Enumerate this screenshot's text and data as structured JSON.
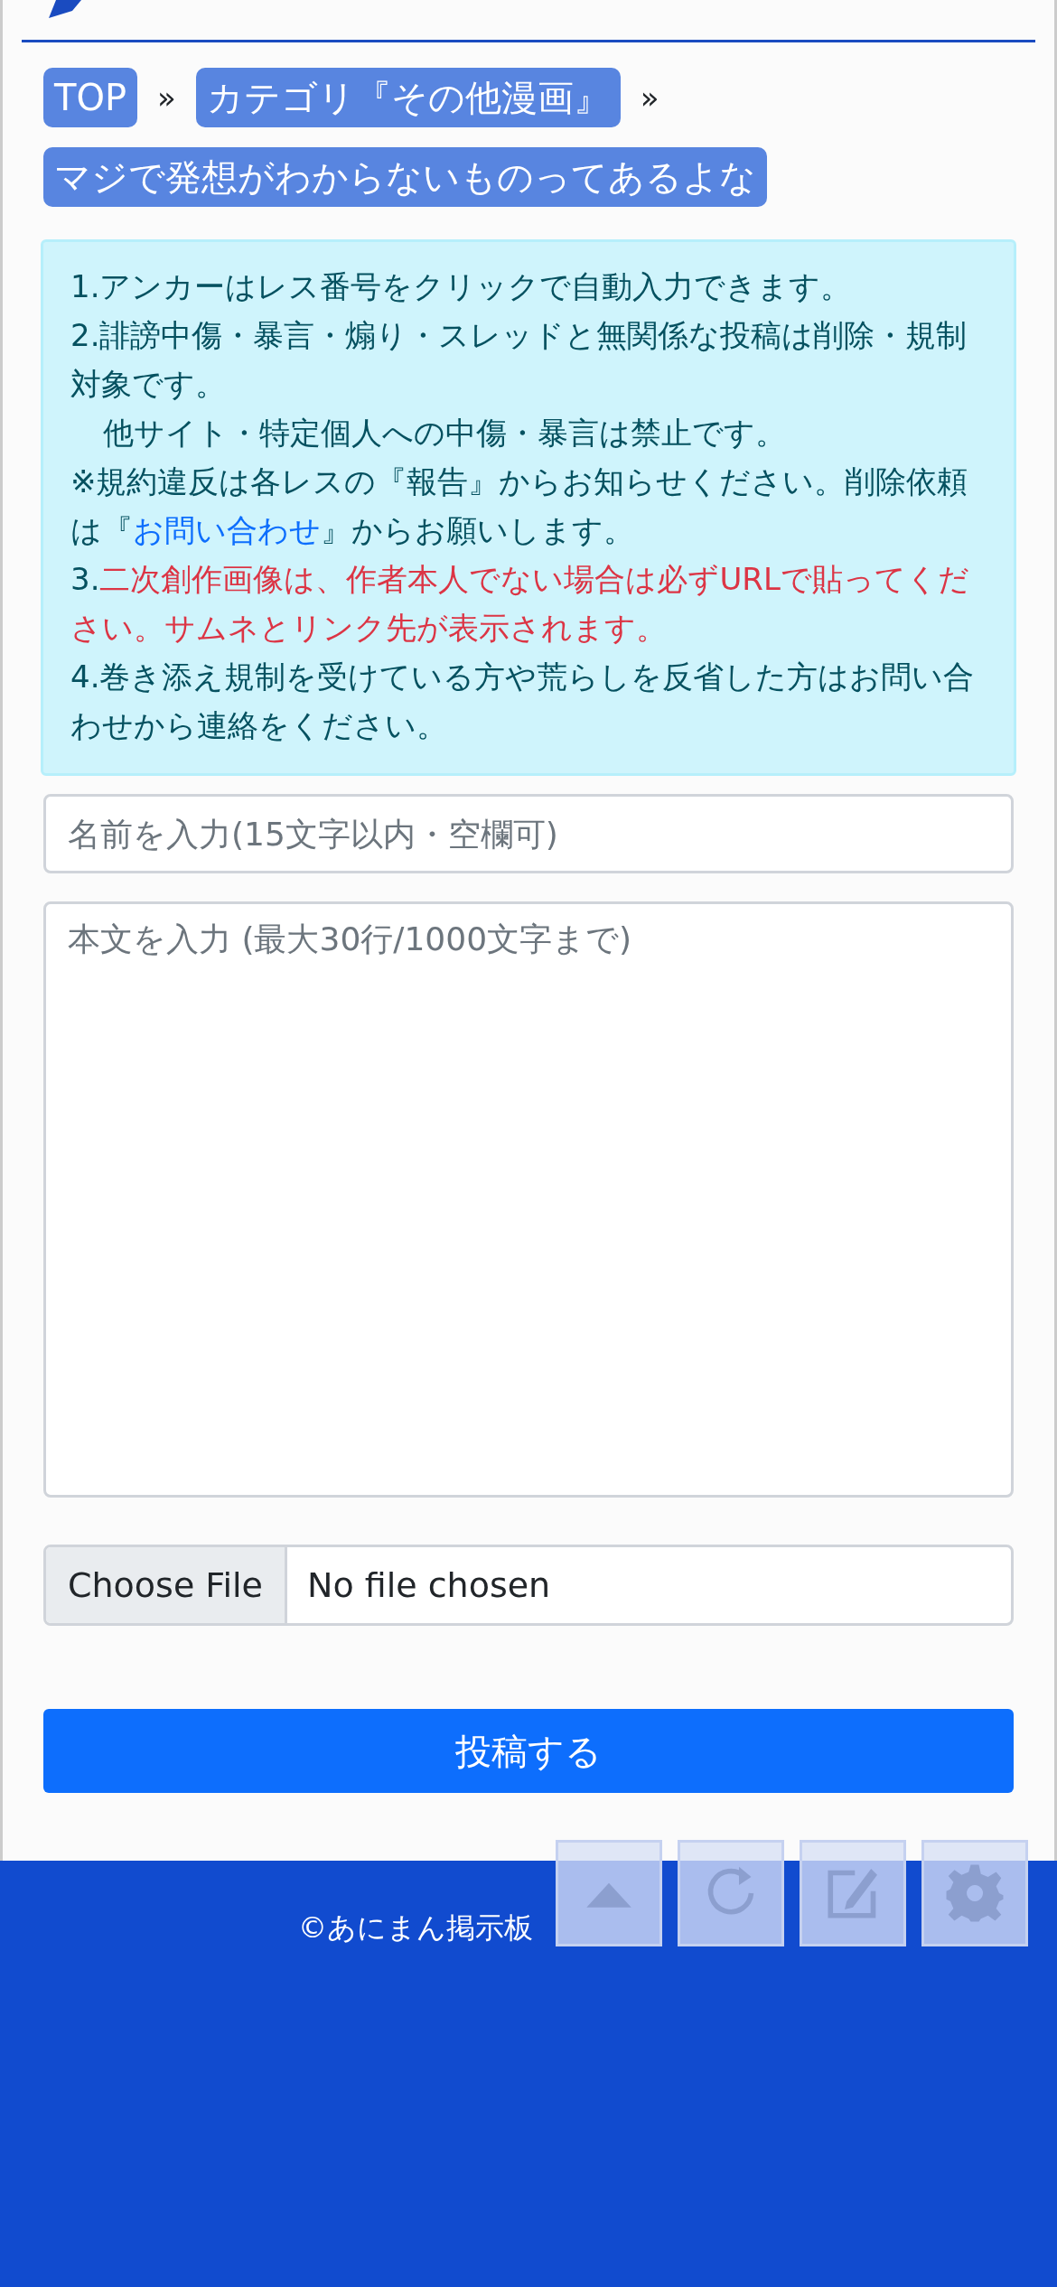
{
  "breadcrumbs": [
    {
      "label": "TOP"
    },
    {
      "label": "カテゴリ『その他漫画』"
    },
    {
      "label": "マジで発想がわからないものってあるよな"
    }
  ],
  "breadcrumb_separator": "»",
  "notice": [
    {
      "kind": "plain",
      "text": "1.アンカーはレス番号をクリックで自動入力できます。"
    },
    {
      "kind": "plain",
      "text": "2.誹謗中傷・暴言・煽り・スレッドと無関係な投稿は削除・規制対象です。"
    },
    {
      "kind": "indent",
      "text": "他サイト・特定個人への中傷・暴言は禁止です。"
    },
    {
      "kind": "link",
      "before": "※規約違反は各レスの『報告』からお知らせください。削除依頼は『",
      "link": "お問い合わせ",
      "after": "』からお願いします。"
    },
    {
      "kind": "alert",
      "prefix": "3.",
      "text": "二次創作画像は、作者本人でない場合は必ずURLで貼ってください。サムネとリンク先が表示されます。"
    },
    {
      "kind": "plain",
      "text": "4.巻き添え規制を受けている方や荒らしを反省した方はお問い合わせから連絡をください。"
    }
  ],
  "name_field": {
    "placeholder": "名前を入力(15文字以内・空欄可)"
  },
  "body_field": {
    "placeholder": "本文を入力 (最大30行/1000文字まで)"
  },
  "file_input": {
    "button": "Choose File",
    "status": "No file chosen"
  },
  "submit_button": "投稿する",
  "footer": {
    "copyright": "©あにまん掲示板"
  },
  "floating_buttons": [
    {
      "kind": "up"
    },
    {
      "kind": "reload"
    },
    {
      "kind": "edit"
    },
    {
      "kind": "settings"
    }
  ]
}
